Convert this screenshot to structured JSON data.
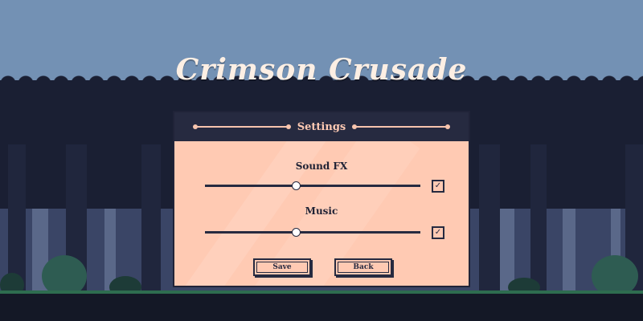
{
  "game": {
    "title": "Crimson Crusade"
  },
  "settings_panel": {
    "title": "Settings",
    "items": [
      {
        "label": "Sound FX",
        "volume": 0.42,
        "enabled": true
      },
      {
        "label": "Music",
        "volume": 0.42,
        "enabled": true
      }
    ],
    "buttons": {
      "save": "Save",
      "back": "Back"
    }
  },
  "colors": {
    "sky": "#7391b4",
    "panel_background": "#ffcab3",
    "panel_header": "#262a40",
    "title_text": "#fcefe4"
  },
  "icons": {
    "checkbox_mark": "checkmark-icon"
  }
}
